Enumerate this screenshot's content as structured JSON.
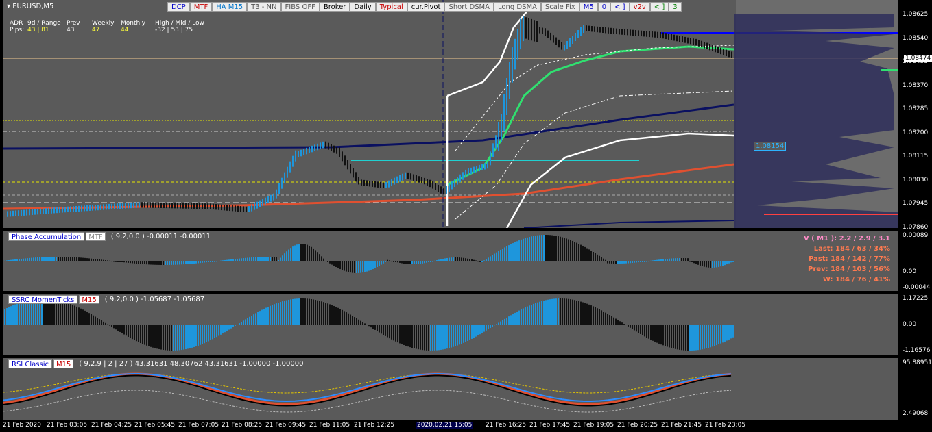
{
  "symbol": "EURUSD,M5",
  "toolbar": [
    {
      "label": "DCP",
      "color": "#0000c8"
    },
    {
      "label": "MTF",
      "color": "#c80000"
    },
    {
      "label": "HA M15",
      "color": "#0073c8"
    },
    {
      "label": "T3 - NN",
      "color": "#555555"
    },
    {
      "label": "FIBS OFF",
      "color": "#555555"
    },
    {
      "label": "Broker",
      "color": "#000000"
    },
    {
      "label": "Daily",
      "color": "#000000"
    },
    {
      "label": "Typical",
      "color": "#c80000"
    },
    {
      "label": "cur.Pivot",
      "color": "#000000"
    },
    {
      "label": "Short DSMA",
      "color": "#555555"
    },
    {
      "label": "Long DSMA",
      "color": "#555555"
    },
    {
      "label": "Scale Fix",
      "color": "#555555"
    },
    {
      "label": "M5",
      "color": "#0000c8"
    },
    {
      "label": "0",
      "color": "#0000c8"
    },
    {
      "label": "< ]",
      "color": "#0000c8"
    },
    {
      "label": "v2v",
      "color": "#c80000"
    },
    {
      "label": "< ]",
      "color": "#008000"
    },
    {
      "label": "3",
      "color": "#008000"
    }
  ],
  "stats": {
    "adr_label": "ADR",
    "pips_label": "Pips:",
    "range_label": "9d / Range",
    "range_value": "43 | 81",
    "prev_label": "Prev",
    "prev_value": "43",
    "weekly_label": "Weekly",
    "weekly_value": "47",
    "monthly_label": "Monthly",
    "monthly_value": "44",
    "hml_label": "High / Mid / Low",
    "hml_value": "-32 | 53 | 75"
  },
  "price_axis": [
    "1.08625",
    "1.08540",
    "1.08455",
    "1.08370",
    "1.08285",
    "1.08200",
    "1.08115",
    "1.08030",
    "1.07945",
    "1.07860"
  ],
  "last_price": "1.08474",
  "marker_price": "1.08154",
  "panel1": {
    "name": "Phase Accumulation",
    "tf": "MTF",
    "tf_color": "#888888",
    "params": "( 9,2,0.0 ) -0.00011 -0.00011",
    "axis": [
      "0.00089",
      "0.00",
      "-0.00044"
    ],
    "vstats": [
      {
        "text": "V ( M1 ): 2.2 / 2.9 / 3.1",
        "color": "#ff8cc8"
      },
      {
        "text": "Last: 184 / 63 / 34%",
        "color": "#ff7a50"
      },
      {
        "text": "Past: 184 / 142 / 77%",
        "color": "#ff7a50"
      },
      {
        "text": "Prev: 184 / 103 / 56%",
        "color": "#ff7a50"
      },
      {
        "text": "W: 184 / 76 / 41%",
        "color": "#ff7a50"
      }
    ]
  },
  "panel2": {
    "name": "SSRC MomenTicks",
    "tf": "M15",
    "tf_color": "#c80000",
    "params": "( 9,2,0.0 ) -1.05687 -1.05687",
    "axis": [
      "1.17225",
      "0.00",
      "-1.16576"
    ]
  },
  "panel3": {
    "name": "RSI Classic",
    "tf": "M15",
    "tf_color": "#c80000",
    "params": "( 9,2,9 | 2 | 27 ) 43.31631 48.30762 43.31631 -1.00000 -1.00000",
    "axis": [
      "95.88951",
      "2.49068"
    ]
  },
  "time_axis": [
    "21 Feb 2020",
    "21 Feb 03:05",
    "21 Feb 04:25",
    "21 Feb 05:45",
    "21 Feb 07:05",
    "21 Feb 08:25",
    "21 Feb 09:45",
    "21 Feb 11:05",
    "21 Feb 12:25",
    "2020.02.21 15:05",
    "21 Feb 16:25",
    "21 Feb 17:45",
    "21 Feb 19:05",
    "21 Feb 20:25",
    "21 Feb 21:45",
    "21 Feb 23:05"
  ],
  "colors": {
    "up": "#1e96dc",
    "down": "#111111",
    "accent": "#2db3ff"
  }
}
